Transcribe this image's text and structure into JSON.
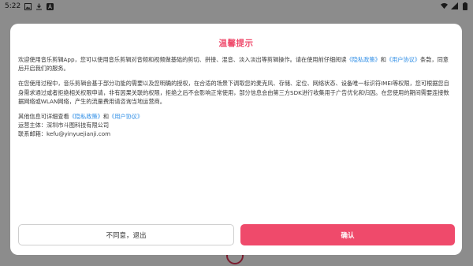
{
  "status_bar": {
    "time": "5:22",
    "icons": [
      "image-icon",
      "download-icon",
      "a-icon"
    ],
    "right_icons": [
      "wifi-icon",
      "signal-icon",
      "battery-icon"
    ]
  },
  "colors": {
    "accent": "#ef4a6b",
    "link": "#2f8ee6",
    "overlay": "#8c8c8c"
  },
  "dialog": {
    "title": "温馨提示",
    "p1": {
      "text_before": "欢迎使用音乐剪辑App，您可以使用音乐剪辑对音频和视频做基础的剪切、拼接、混音、淡入淡出等剪辑操作。请在使用前仔细阅读",
      "link_privacy": "《隐私政策》",
      "and": "和",
      "link_user": "《用户协议》",
      "text_after": "条款，同意后开启我们的服务。"
    },
    "p2": "在您使用过程中，音乐剪辑会基于部分功能的需要以及您明确的授权，在合适的场景下调取您的麦克风、存储、定位、网络状态、设备唯一标识符IMEI等权限，您可根据您自身需求通过或者拒绝相关权限申请，非有因果关联的权限，拒绝之后不会影响正常使用，部分信息会由第三方SDK进行收集用于广告优化和归因。在您使用的期间需要连接数据网络或WLAN网络，产生的流量费用请咨询当地运营商。",
    "p3": {
      "text_before": "其他信息可详细查看",
      "link_privacy": "《隐私政策》",
      "and": "和",
      "link_user": "《用户协议》",
      "operator": "运营主体：深圳市斗图科技有限公司",
      "email": "联系邮箱：kefu@yinyuejianji.com"
    },
    "decline_label": "不同意，退出",
    "confirm_label": "确认"
  }
}
